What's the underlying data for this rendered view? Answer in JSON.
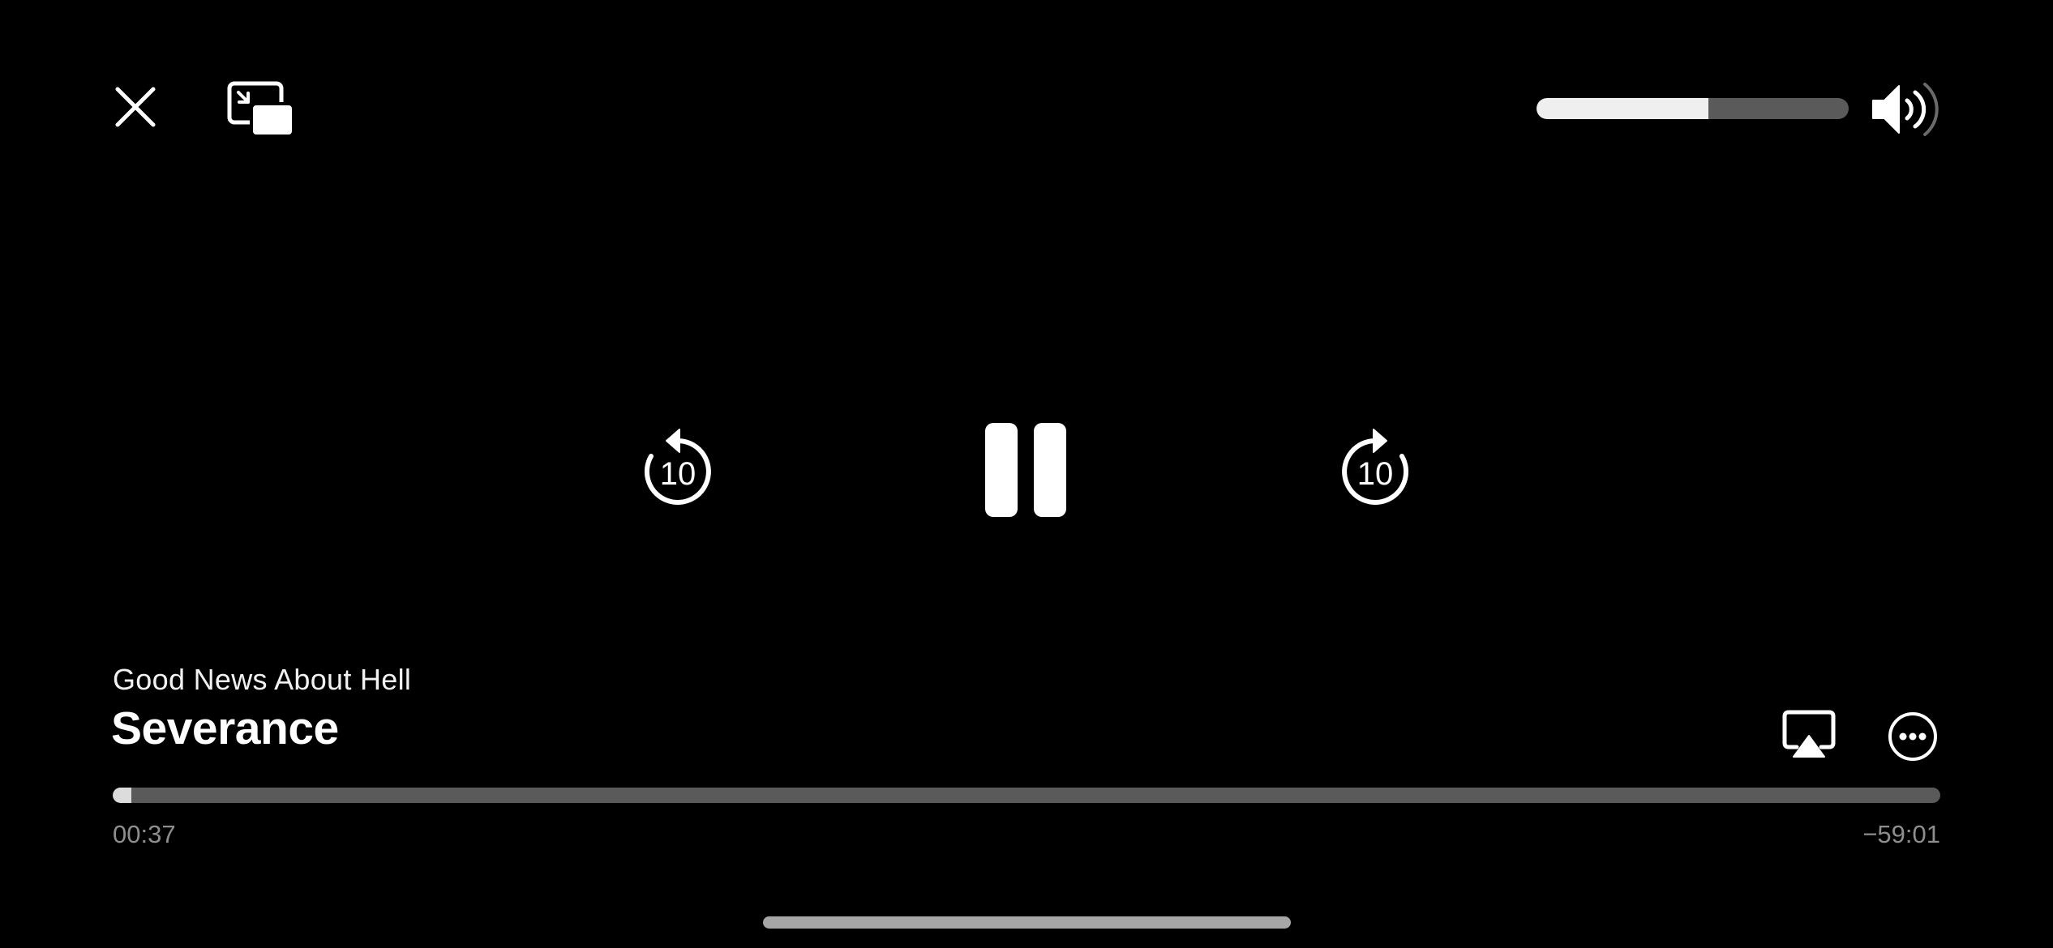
{
  "player": {
    "episode_title": "Good News About Hell",
    "show_title": "Severance",
    "elapsed_time": "00:37",
    "remaining_time": "−59:01",
    "progress_percent": 1,
    "volume_percent": 55,
    "skip_back_seconds": "10",
    "skip_forward_seconds": "10"
  },
  "icons": {
    "close": "close-icon",
    "pip": "picture-in-picture-icon",
    "volume": "speaker-wave-icon",
    "skip_back": "skip-back-10-icon",
    "pause": "pause-icon",
    "skip_forward": "skip-forward-10-icon",
    "airplay": "airplay-icon",
    "more": "more-ellipsis-icon"
  },
  "colors": {
    "background": "#000000",
    "foreground": "#ffffff",
    "track": "#5a5a5a",
    "muted_text": "#8e8e8e"
  }
}
